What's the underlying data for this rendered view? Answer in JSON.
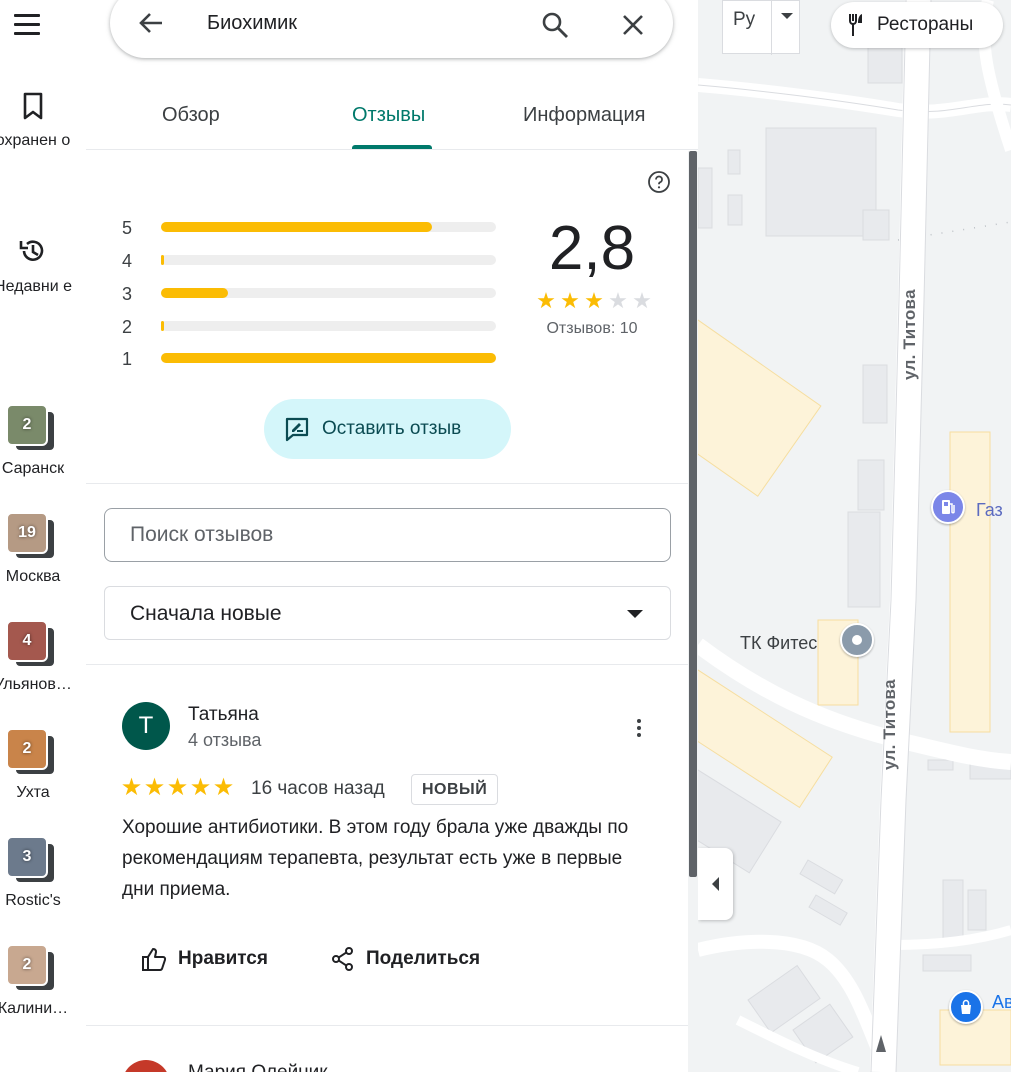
{
  "rail": {
    "saved_label": "охранен о",
    "recent_label": "Недавни е",
    "recent_places": [
      {
        "name": "Саранск",
        "count": "2",
        "color": "#7a8a6a"
      },
      {
        "name": "Москва",
        "count": "19",
        "color": "#b59a84"
      },
      {
        "name": "Ульянов…",
        "count": "4",
        "color": "#a4584e"
      },
      {
        "name": "Ухта",
        "count": "2",
        "color": "#c9844a"
      },
      {
        "name": "Rostic's",
        "count": "3",
        "color": "#6c7a8c"
      },
      {
        "name": "Калини…",
        "count": "2",
        "color": "#c8a890"
      }
    ]
  },
  "search": {
    "query": "Биохимик"
  },
  "tabs": [
    {
      "label": "Обзор",
      "active": false
    },
    {
      "label": "Отзывы",
      "active": true
    },
    {
      "label": "Информация",
      "active": false
    }
  ],
  "rating_summary": {
    "rating": "2,8",
    "stars": 3,
    "reviews_count_text": "Отзывов: 10",
    "histogram": [
      {
        "stars": "5",
        "fraction": 0.81
      },
      {
        "stars": "4",
        "fraction": 0.0
      },
      {
        "stars": "3",
        "fraction": 0.2
      },
      {
        "stars": "2",
        "fraction": 0.0
      },
      {
        "stars": "1",
        "fraction": 1.0
      }
    ]
  },
  "write_review": {
    "label": "Оставить отзыв"
  },
  "review_search": {
    "placeholder": "Поиск отзывов"
  },
  "sort": {
    "selected": "Сначала новые"
  },
  "review": {
    "avatar_letter": "Т",
    "author": "Татьяна",
    "author_subtitle": "4 отзыва",
    "stars": 5,
    "time": "16 часов назад",
    "badge": "НОВЫЙ",
    "text": "Хорошие антибиотики. В этом году брала уже дважды по рекомендациям терапевта, результат есть уже в первые дни приема.",
    "like_label": "Нравится",
    "share_label": "Поделиться"
  },
  "next_review": {
    "author": "Мария Олейник"
  },
  "map": {
    "language_button": "Ру",
    "category_chip": "Рестораны",
    "street_label_1": "ул. Титова",
    "street_label_2": "ул. Титова",
    "poi_gas": "Газ",
    "poi_mall": "ТК Фитес",
    "poi_shop": "Ав"
  },
  "colors": {
    "accent": "#00796b",
    "star": "#fbbc04",
    "write_review_bg": "#d4f6fa",
    "gas_pin": "#7b86e8",
    "mall_pin": "#8b9bab",
    "shop_pin": "#1a73e8"
  }
}
